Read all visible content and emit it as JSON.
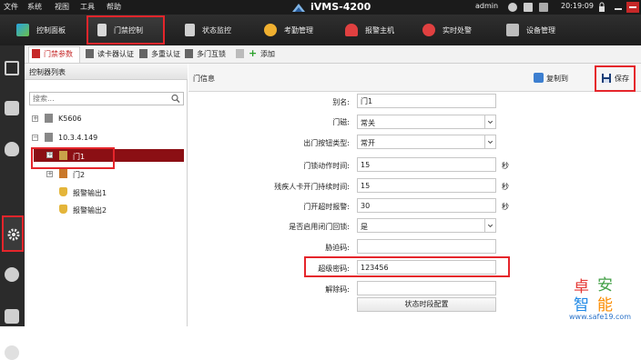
{
  "titlebar": {
    "menus": [
      "文件",
      "系统",
      "视图",
      "工具",
      "帮助"
    ],
    "app_title": "iVMS-4200",
    "user": "admin",
    "clock": "20:19:09"
  },
  "modules": [
    {
      "label": "控制面板"
    },
    {
      "label": "门禁控制"
    },
    {
      "label": "状态监控"
    },
    {
      "label": "考勤管理"
    },
    {
      "label": "报警主机"
    },
    {
      "label": "实时处警"
    },
    {
      "label": "设备管理"
    }
  ],
  "subtabs": {
    "door_params": "门禁参数",
    "reader_auth": "读卡器认证",
    "multi_auth": "多重认证",
    "interlock": "多门互锁",
    "add": "添加"
  },
  "controller_list": {
    "title": "控制器列表",
    "search_placeholder": "搜索...",
    "nodes": {
      "k5606": "K5606",
      "ip": "10.3.4.149",
      "door1": "门1",
      "door2": "门2",
      "alarm_out1": "报警输出1",
      "alarm_out2": "报警输出2"
    }
  },
  "door_info": {
    "title": "门信息",
    "copy_to": "复制到",
    "save": "保存",
    "fields": {
      "alias_label": "别名:",
      "alias_value": "门1",
      "magnet_label": "门磁:",
      "magnet_value": "常关",
      "exit_btn_label": "出门按钮类型:",
      "exit_btn_value": "常开",
      "lock_time_label": "门锁动作时间:",
      "lock_time_value": "15",
      "disabled_time_label": "残疾人卡开门持续时间:",
      "disabled_time_value": "15",
      "overtime_label": "门开超时报警:",
      "overtime_value": "30",
      "close_lock_label": "是否启用闭门回锁:",
      "close_lock_value": "是",
      "duress_label": "胁迫码:",
      "duress_value": "",
      "super_pw_label": "超级密码:",
      "super_pw_value": "123456",
      "dismiss_label": "解除码:",
      "dismiss_value": "",
      "unit_seconds": "秒",
      "time_config_button": "状态时段配置"
    }
  },
  "watermark": {
    "chars": [
      "卓",
      "安",
      "智",
      "能"
    ],
    "url": "www.safe19.com"
  },
  "colors": {
    "highlight_red": "#e5252b",
    "selected_row": "#8b0f14",
    "topbar": "#1b1b1b"
  }
}
